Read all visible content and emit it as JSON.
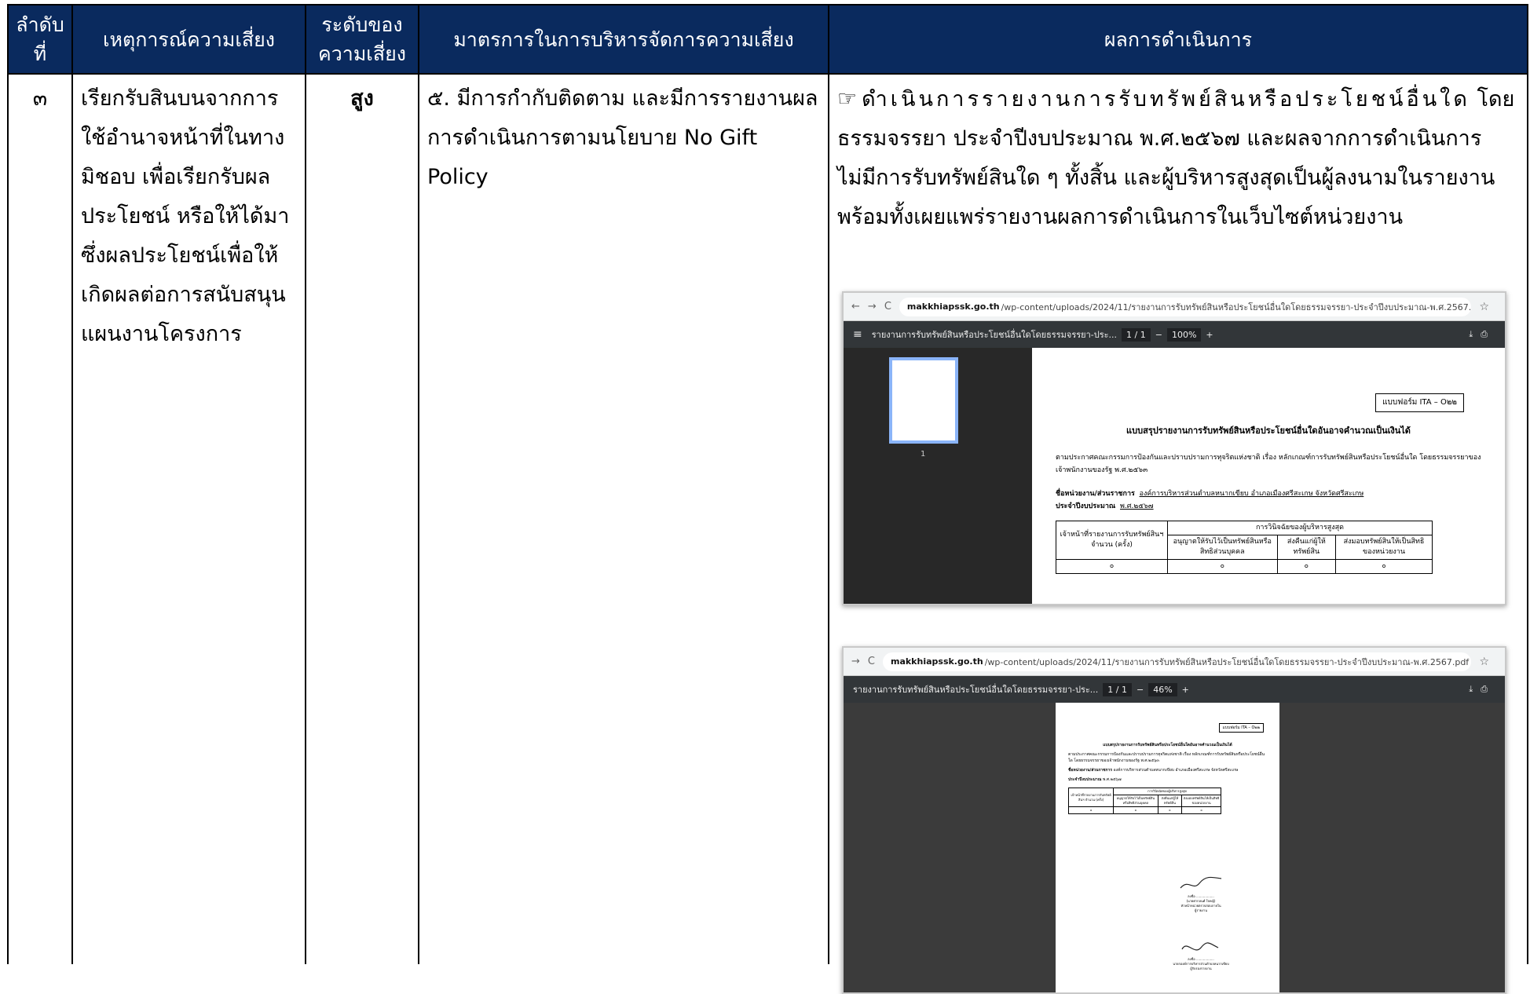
{
  "headers": {
    "no": "ลำดับที่",
    "event": "เหตุการณ์ความเสี่ยง",
    "level": "ระดับของความเสี่ยง",
    "measures": "มาตรการในการบริหารจัดการความเสี่ยง",
    "results": "ผลการดำเนินการ"
  },
  "row": {
    "no": "๓",
    "event": "เรียกรับสินบนจากการใช้อำนาจหน้าที่ในทางมิชอบ เพื่อเรียกรับผลประโยชน์ หรือให้ได้มาซึ่งผลประโยชน์เพื่อให้เกิดผลต่อการสนับสนุนแผนงานโครงการ",
    "level": "สูง",
    "measure": "๕. มีการกำกับติดตาม และมีการรายงานผลการดำเนินการตามนโยบาย No Gift Policy",
    "result_icon": "☞",
    "result_line1": "ดำเนินการรายงานการรับทรัพย์สินหรือประโยชน์อื่นใด",
    "result_rest": "โดยธรรมจรรยา ประจำปีงบประมาณ พ.ศ.๒๕๖๗ และผลจากการดำเนินการไม่มีการรับทรัพย์สินใด ๆ ทั้งสิ้น และผู้บริหารสูงสุดเป็นผู้ลงนามในรายงานพร้อมทั้งเผยแพร่รายงานผลการดำเนินการในเว็บไซต์หน่วยงาน"
  },
  "shot1": {
    "url_host": "makkhiapssk.go.th",
    "url_path": "/wp-content/uploads/2024/11/รายงานการรับทรัพย์สินหรือประโยชน์อื่นใดโดยธรรมจรรยา-ประจำปีงบประมาณ-พ.ศ.2567.pdf",
    "doc_title": "รายงานการรับทรัพย์สินหรือประโยชน์อื่นใดโดยธรรมจรรยา-ประ...",
    "page": "1 / 1",
    "zoom": "100%",
    "thumb_num": "1",
    "form_label": "แบบฟอร์ม ITA – O๒๒",
    "form_title": "แบบสรุปรายงานการรับทรัพย์สินหรือประโยชน์อื่นใดอันอาจคำนวณเป็นเงินได้",
    "paragraph": "ตามประกาศคณะกรรมการป้องกันและปราบปรามการทุจริตแห่งชาติ เรื่อง หลักเกณฑ์การรับทรัพย์สินหรือประโยชน์อื่นใด โดยธรรมจรรยาของเจ้าพนักงานของรัฐ พ.ศ.๒๕๖๓",
    "agency_label": "ชื่อหน่วยงาน/ส่วนราชการ",
    "agency_value": "องค์การบริหารส่วนตำบลหนากเขียบ อำเภอเมืองศรีสะเกษ จังหวัดศรีสะเกษ",
    "fy_label": "ประจำปีงบประมาณ",
    "fy_value": "พ.ศ.๒๕๖๗",
    "col1": "เจ้าหน้าที่รายงานการรับทรัพย์สินฯ จำนวน (ครั้ง)",
    "col_group": "การวินิจฉัยของผู้บริหารสูงสุด",
    "col2": "อนุญาตให้รับไว้เป็นทรัพย์สินหรือสิทธิส่วนบุคคล",
    "col3": "ส่งคืนแก่ผู้ให้ทรัพย์สิน",
    "col4": "ส่งมอบทรัพย์สินให้เป็นสิทธิของหน่วยงาน",
    "zero": "๐"
  },
  "shot2": {
    "zoom": "46%",
    "sign1_name": "(นายศากลนศ์ ใจหญ้)",
    "sign1_role": "หัวหน้าหน่วยตรวจสอบภายใน",
    "sign1_note": "ผู้รายงาน",
    "sign2_role": "นายกองค์การบริหารส่วนตำบลหนากเขียบ",
    "sign2_note": "ผู้รับรองรายงาน",
    "sign_prefix": "ลงชื่อ"
  },
  "icons": {
    "back": "←",
    "forward": "→",
    "reload": "C",
    "menu": "≡",
    "star": "☆",
    "download": "⤓",
    "print": "⎙"
  }
}
